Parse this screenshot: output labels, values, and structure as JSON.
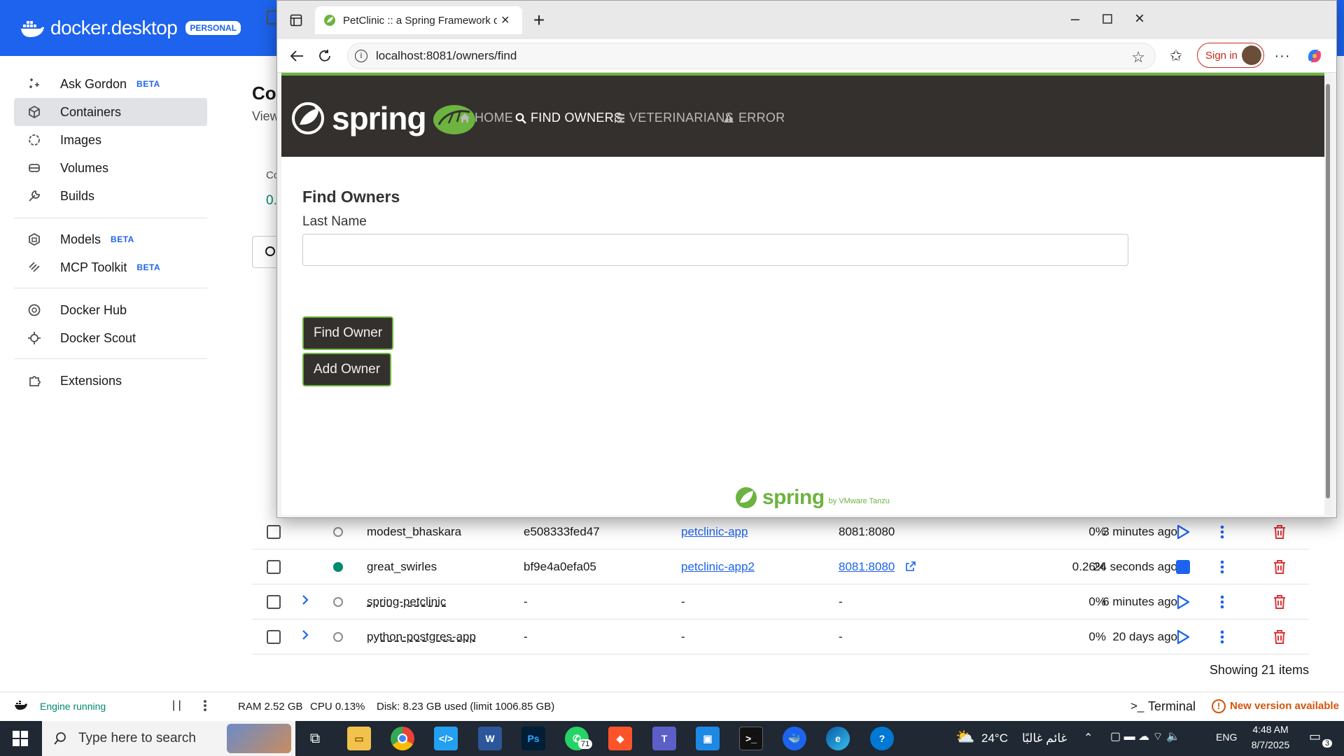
{
  "docker": {
    "brand": "docker.desktop",
    "badge": "PERSONAL",
    "nav": [
      {
        "label": "Ask Gordon",
        "beta": "BETA"
      },
      {
        "label": "Containers"
      },
      {
        "label": "Images"
      },
      {
        "label": "Volumes"
      },
      {
        "label": "Builds"
      },
      {
        "label": "Models",
        "beta": "BETA"
      },
      {
        "label": "MCP Toolkit",
        "beta": "BETA"
      },
      {
        "label": "Docker Hub"
      },
      {
        "label": "Docker Scout"
      },
      {
        "label": "Extensions"
      }
    ],
    "main": {
      "title_fragment": "Co",
      "subtitle_fragment": "View",
      "stat_label_fragment": "Co",
      "stat_value_fragment": "0."
    },
    "rows": [
      {
        "name": "modest_bhaskara",
        "id": "e508333fed47",
        "image": "petclinic-app",
        "ports": "8081:8080",
        "cpu": "0%",
        "last_started": "3 minutes ago"
      },
      {
        "name": "great_swirles",
        "id": "bf9e4a0efa05",
        "image": "petclinic-app2",
        "ports": "8081:8080",
        "cpu": "0.26%",
        "last_started": "24 seconds ago"
      },
      {
        "name": "spring-petclinic",
        "id": "-",
        "image": "-",
        "ports": "-",
        "cpu": "0%",
        "last_started": "6 minutes ago"
      },
      {
        "name": "python-postgres-app",
        "id": "-",
        "image": "-",
        "ports": "-",
        "cpu": "0%",
        "last_started": "20 days ago"
      }
    ],
    "showing": "Showing 21 items",
    "footer": {
      "engine": "Engine running",
      "ram": "RAM 2.52 GB",
      "cpu": "CPU 0.13%",
      "disk": "Disk: 8.23 GB used (limit 1006.85 GB)",
      "terminal": "Terminal",
      "update": "New version available"
    }
  },
  "browser": {
    "tab_title": "PetClinic :: a Spring Framework de",
    "url": "localhost:8081/owners/find",
    "sign_in": "Sign in"
  },
  "petclinic": {
    "logo_word": "spring",
    "nav": [
      "HOME",
      "FIND OWNERS",
      "VETERINARIANS",
      "ERROR"
    ],
    "heading": "Find Owners",
    "field_label": "Last Name",
    "field_value": "",
    "find_button": "Find Owner",
    "add_button": "Add Owner",
    "footer_word": "spring",
    "footer_by": "by VMware Tanzu"
  },
  "taskbar": {
    "search_placeholder": "Type here to search",
    "whatsapp_badge": "71",
    "weather": "24°C",
    "weather_text": "غائم غالبًا",
    "lang": "ENG",
    "time": "4:48 AM",
    "date": "8/7/2025",
    "notifications": "3"
  },
  "colors": {
    "docker_blue": "#1d63ed",
    "spring_green": "#6db33f",
    "petclinic_dark": "#34302d",
    "delete_red": "#d8373c",
    "running_green": "#008a70"
  }
}
